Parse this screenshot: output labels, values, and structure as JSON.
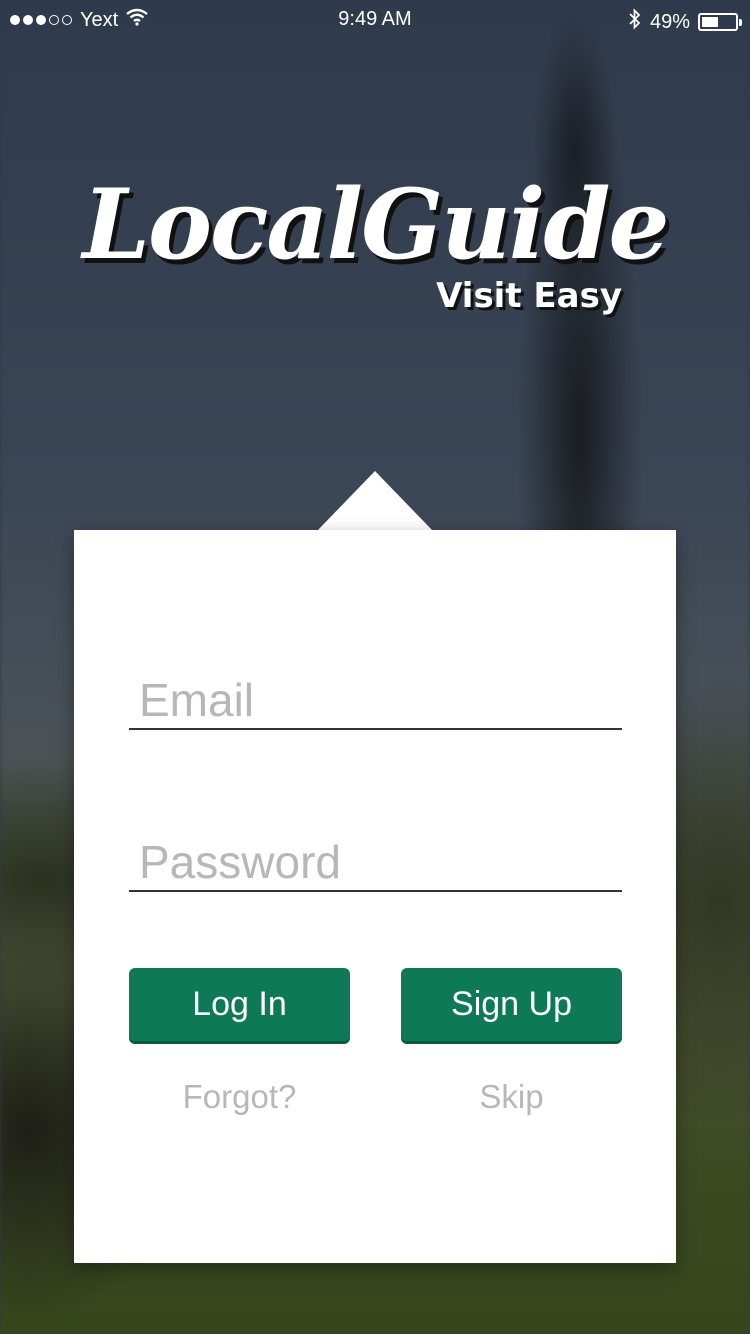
{
  "status_bar": {
    "carrier": "Yext",
    "time": "9:49 AM",
    "battery_percent": "49%",
    "battery_level": 0.49,
    "signal_bars_filled": 3,
    "signal_bars_total": 5
  },
  "logo": {
    "title": "LocalGuide",
    "subtitle": "Visit Easy"
  },
  "login_form": {
    "email_placeholder": "Email",
    "password_placeholder": "Password",
    "login_label": "Log In",
    "signup_label": "Sign Up",
    "forgot_label": "Forgot?",
    "skip_label": "Skip"
  },
  "colors": {
    "primary_button": "#0e7a55",
    "card_background": "#ffffff",
    "placeholder_text": "#b7b7b7"
  },
  "icons": [
    "wifi-icon",
    "bluetooth-icon",
    "battery-icon",
    "signal-dots-icon"
  ]
}
